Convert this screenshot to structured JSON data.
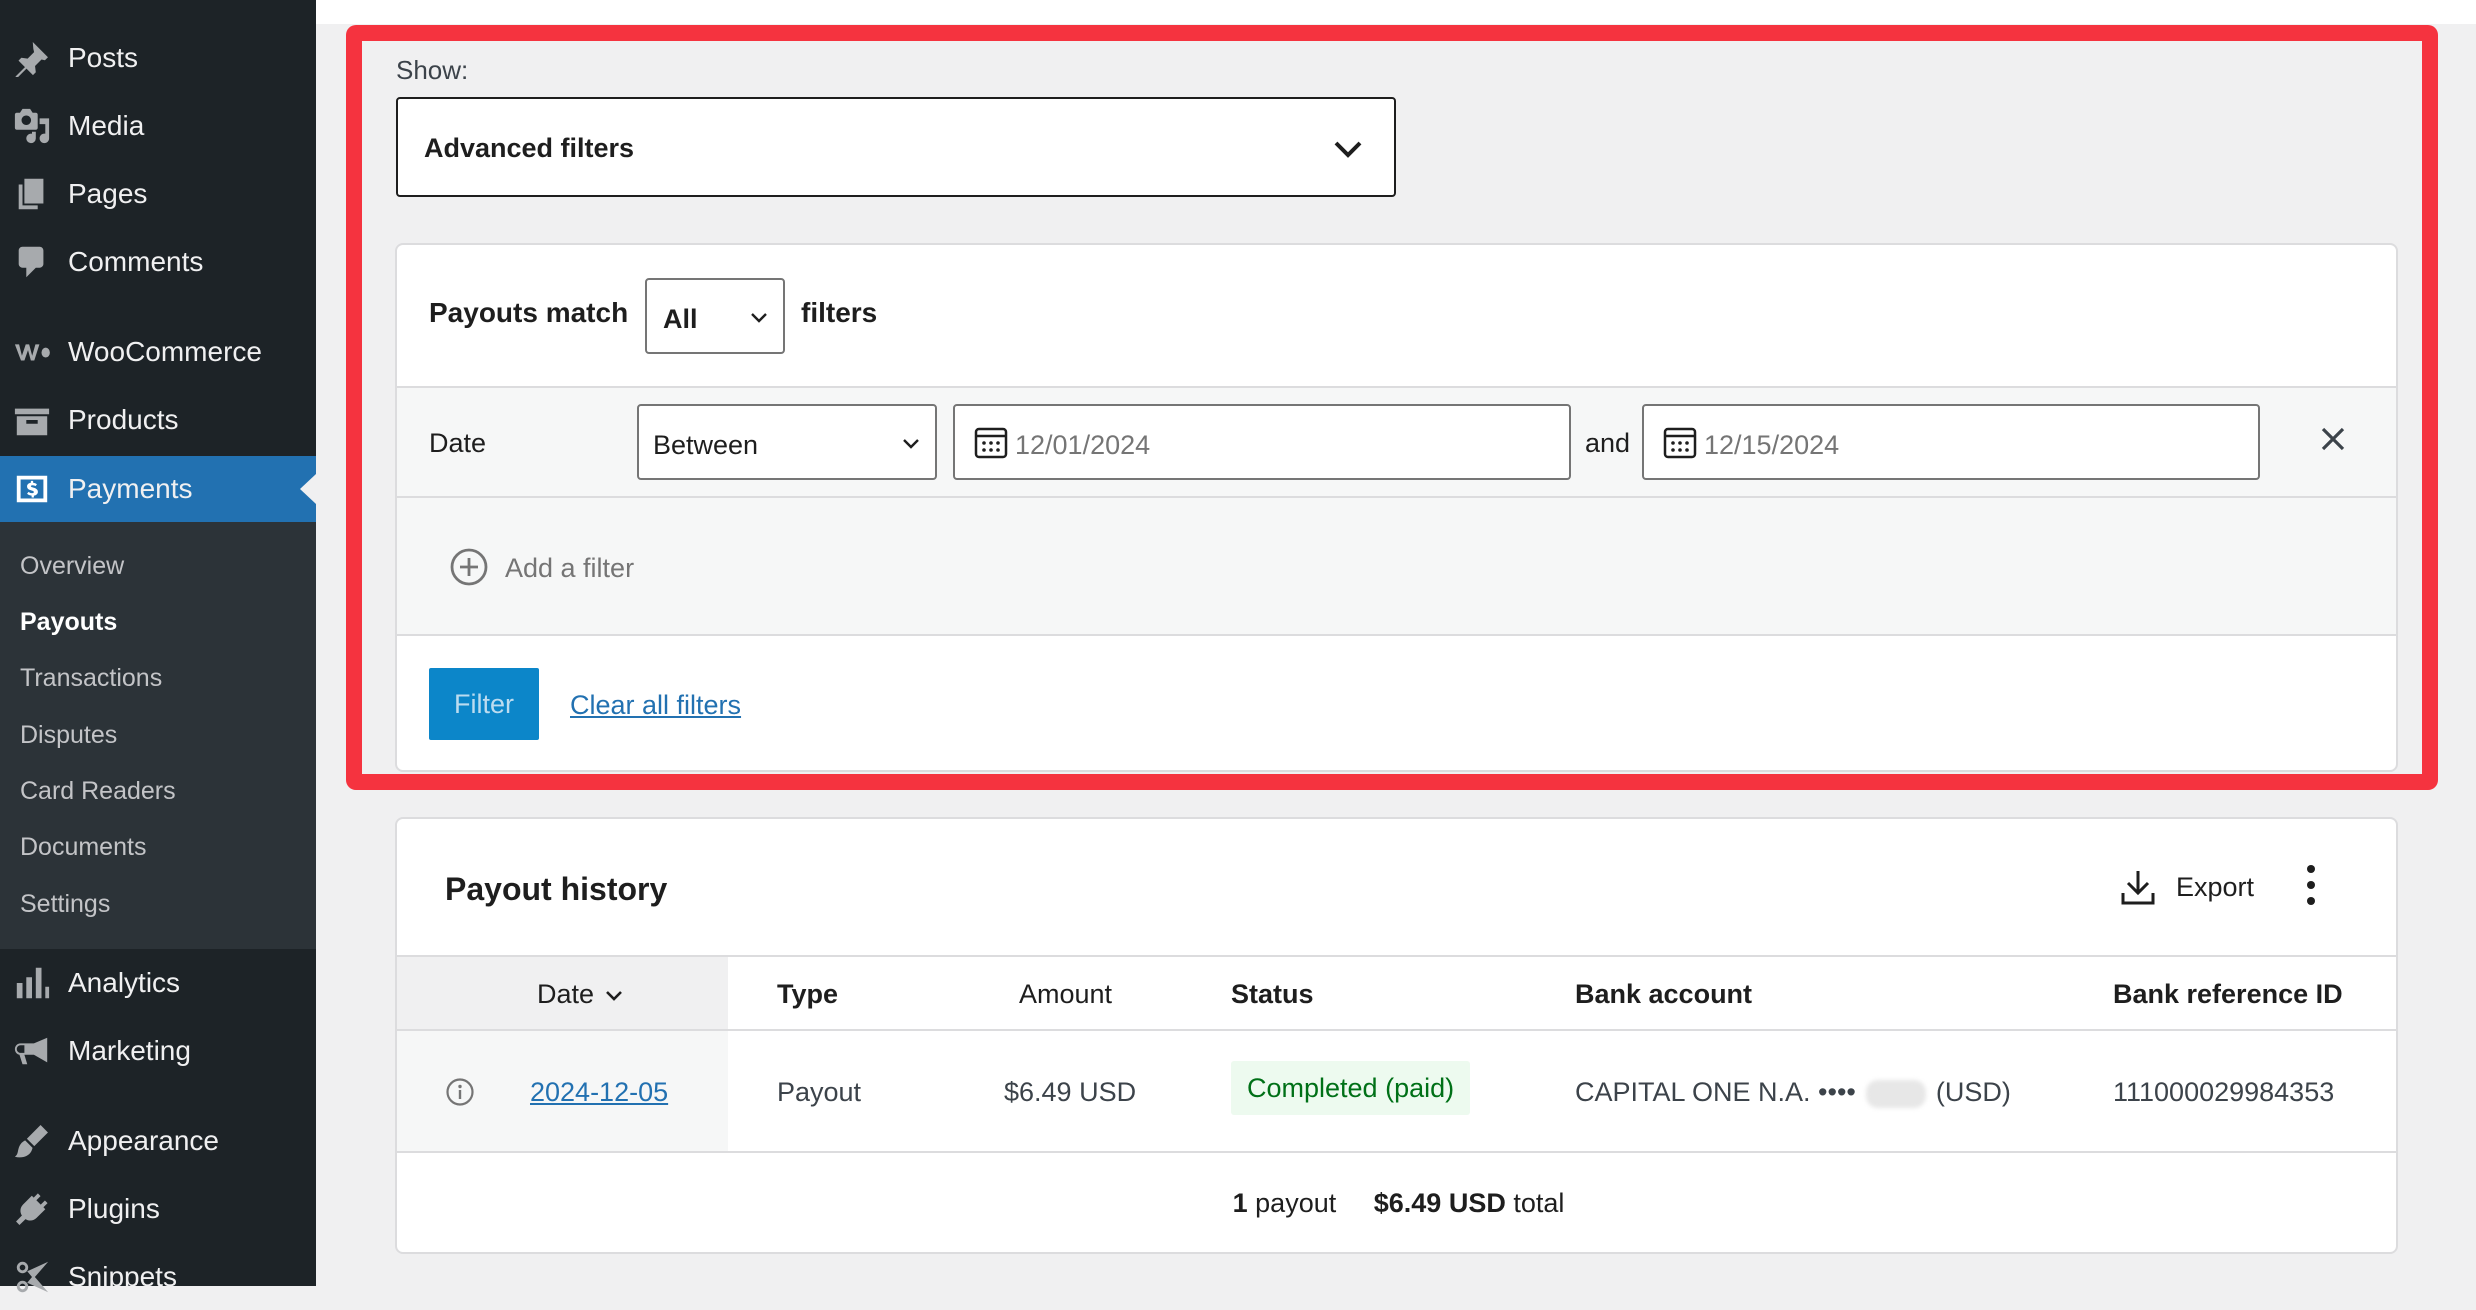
{
  "sidebar": {
    "items": [
      {
        "label": "Posts",
        "icon": "pin-icon"
      },
      {
        "label": "Media",
        "icon": "media-icon"
      },
      {
        "label": "Pages",
        "icon": "pages-icon"
      },
      {
        "label": "Comments",
        "icon": "comment-icon"
      },
      {
        "label": "WooCommerce",
        "icon": "woocommerce-icon"
      },
      {
        "label": "Products",
        "icon": "archive-icon"
      },
      {
        "label": "Payments",
        "icon": "dollar-icon",
        "active": true
      },
      {
        "label": "Analytics",
        "icon": "chart-bar-icon"
      },
      {
        "label": "Marketing",
        "icon": "megaphone-icon"
      },
      {
        "label": "Appearance",
        "icon": "brush-icon"
      },
      {
        "label": "Plugins",
        "icon": "plug-icon"
      },
      {
        "label": "Snippets",
        "icon": "scissors-icon"
      }
    ],
    "submenu": [
      "Overview",
      "Payouts",
      "Transactions",
      "Disputes",
      "Card Readers",
      "Documents",
      "Settings"
    ],
    "current_submenu": "Payouts",
    "active_color": "#2271b1"
  },
  "filters": {
    "show_label": "Show:",
    "show_value": "Advanced filters",
    "match_prefix": "Payouts match",
    "match_value": "All",
    "match_suffix": "filters",
    "date_label": "Date",
    "date_operator": "Between",
    "date_from": "12/01/2024",
    "and_word": "and",
    "date_to": "12/15/2024",
    "add_filter": "Add a filter",
    "filter_button": "Filter",
    "clear_link": "Clear all filters",
    "highlight_color": "#f5333f"
  },
  "history": {
    "title": "Payout history",
    "export_label": "Export",
    "columns": {
      "date": "Date",
      "type": "Type",
      "amount": "Amount",
      "status": "Status",
      "bank_account": "Bank account",
      "bank_ref": "Bank reference ID"
    },
    "rows": [
      {
        "date": "2024-12-05",
        "type": "Payout",
        "amount": "$6.49 USD",
        "status": "Completed (paid)",
        "bank_account_prefix": "CAPITAL ONE N.A. ••••",
        "bank_account_suffix": "(USD)",
        "bank_ref": "111000029984353"
      }
    ],
    "summary": {
      "count": "1",
      "count_label": "payout",
      "total": "$6.49 USD",
      "total_label": "total"
    },
    "status_color": "#007017"
  }
}
